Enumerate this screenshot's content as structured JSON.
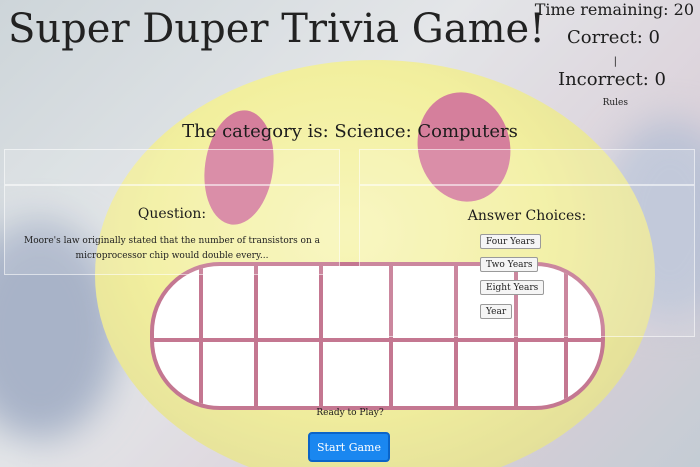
{
  "header": {
    "title": "Super Duper Trivia Game!"
  },
  "score": {
    "time_label": "Time remaining: 20",
    "correct_label": "Correct: 0",
    "separator": "|",
    "incorrect_label": "Incorrect: 0",
    "rules_label": "Rules"
  },
  "category_label": "The category is: Science: Computers",
  "question": {
    "heading": "Question:",
    "text": "Moore's law originally stated that the number of transistors on a microprocessor chip would double every..."
  },
  "answers": {
    "heading": "Answer Choices:",
    "choices": [
      "Four Years",
      "Two Years",
      "Eight Years",
      "Year"
    ]
  },
  "footer": {
    "ready_label": "Ready to Play?",
    "start_label": "Start Game"
  },
  "colors": {
    "start_button": "#1a87f0",
    "face_yellow": "#ece870",
    "eye_pink": "#c2436e"
  }
}
